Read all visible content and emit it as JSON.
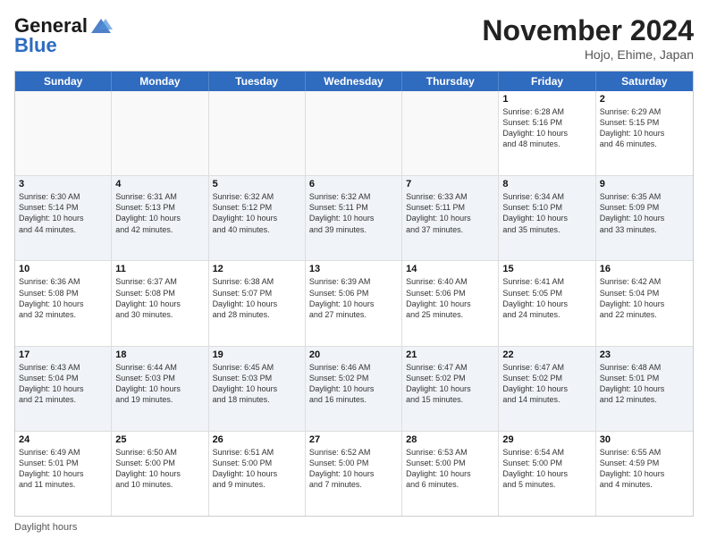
{
  "header": {
    "logo_line1": "General",
    "logo_line2": "Blue",
    "month_title": "November 2024",
    "location": "Hojo, Ehime, Japan"
  },
  "weekdays": [
    "Sunday",
    "Monday",
    "Tuesday",
    "Wednesday",
    "Thursday",
    "Friday",
    "Saturday"
  ],
  "footer": {
    "daylight_label": "Daylight hours"
  },
  "rows": [
    [
      {
        "day": "",
        "text": "",
        "empty": true
      },
      {
        "day": "",
        "text": "",
        "empty": true
      },
      {
        "day": "",
        "text": "",
        "empty": true
      },
      {
        "day": "",
        "text": "",
        "empty": true
      },
      {
        "day": "",
        "text": "",
        "empty": true
      },
      {
        "day": "1",
        "text": "Sunrise: 6:28 AM\nSunset: 5:16 PM\nDaylight: 10 hours\nand 48 minutes.",
        "empty": false
      },
      {
        "day": "2",
        "text": "Sunrise: 6:29 AM\nSunset: 5:15 PM\nDaylight: 10 hours\nand 46 minutes.",
        "empty": false
      }
    ],
    [
      {
        "day": "3",
        "text": "Sunrise: 6:30 AM\nSunset: 5:14 PM\nDaylight: 10 hours\nand 44 minutes.",
        "empty": false
      },
      {
        "day": "4",
        "text": "Sunrise: 6:31 AM\nSunset: 5:13 PM\nDaylight: 10 hours\nand 42 minutes.",
        "empty": false
      },
      {
        "day": "5",
        "text": "Sunrise: 6:32 AM\nSunset: 5:12 PM\nDaylight: 10 hours\nand 40 minutes.",
        "empty": false
      },
      {
        "day": "6",
        "text": "Sunrise: 6:32 AM\nSunset: 5:11 PM\nDaylight: 10 hours\nand 39 minutes.",
        "empty": false
      },
      {
        "day": "7",
        "text": "Sunrise: 6:33 AM\nSunset: 5:11 PM\nDaylight: 10 hours\nand 37 minutes.",
        "empty": false
      },
      {
        "day": "8",
        "text": "Sunrise: 6:34 AM\nSunset: 5:10 PM\nDaylight: 10 hours\nand 35 minutes.",
        "empty": false
      },
      {
        "day": "9",
        "text": "Sunrise: 6:35 AM\nSunset: 5:09 PM\nDaylight: 10 hours\nand 33 minutes.",
        "empty": false
      }
    ],
    [
      {
        "day": "10",
        "text": "Sunrise: 6:36 AM\nSunset: 5:08 PM\nDaylight: 10 hours\nand 32 minutes.",
        "empty": false
      },
      {
        "day": "11",
        "text": "Sunrise: 6:37 AM\nSunset: 5:08 PM\nDaylight: 10 hours\nand 30 minutes.",
        "empty": false
      },
      {
        "day": "12",
        "text": "Sunrise: 6:38 AM\nSunset: 5:07 PM\nDaylight: 10 hours\nand 28 minutes.",
        "empty": false
      },
      {
        "day": "13",
        "text": "Sunrise: 6:39 AM\nSunset: 5:06 PM\nDaylight: 10 hours\nand 27 minutes.",
        "empty": false
      },
      {
        "day": "14",
        "text": "Sunrise: 6:40 AM\nSunset: 5:06 PM\nDaylight: 10 hours\nand 25 minutes.",
        "empty": false
      },
      {
        "day": "15",
        "text": "Sunrise: 6:41 AM\nSunset: 5:05 PM\nDaylight: 10 hours\nand 24 minutes.",
        "empty": false
      },
      {
        "day": "16",
        "text": "Sunrise: 6:42 AM\nSunset: 5:04 PM\nDaylight: 10 hours\nand 22 minutes.",
        "empty": false
      }
    ],
    [
      {
        "day": "17",
        "text": "Sunrise: 6:43 AM\nSunset: 5:04 PM\nDaylight: 10 hours\nand 21 minutes.",
        "empty": false
      },
      {
        "day": "18",
        "text": "Sunrise: 6:44 AM\nSunset: 5:03 PM\nDaylight: 10 hours\nand 19 minutes.",
        "empty": false
      },
      {
        "day": "19",
        "text": "Sunrise: 6:45 AM\nSunset: 5:03 PM\nDaylight: 10 hours\nand 18 minutes.",
        "empty": false
      },
      {
        "day": "20",
        "text": "Sunrise: 6:46 AM\nSunset: 5:02 PM\nDaylight: 10 hours\nand 16 minutes.",
        "empty": false
      },
      {
        "day": "21",
        "text": "Sunrise: 6:47 AM\nSunset: 5:02 PM\nDaylight: 10 hours\nand 15 minutes.",
        "empty": false
      },
      {
        "day": "22",
        "text": "Sunrise: 6:47 AM\nSunset: 5:02 PM\nDaylight: 10 hours\nand 14 minutes.",
        "empty": false
      },
      {
        "day": "23",
        "text": "Sunrise: 6:48 AM\nSunset: 5:01 PM\nDaylight: 10 hours\nand 12 minutes.",
        "empty": false
      }
    ],
    [
      {
        "day": "24",
        "text": "Sunrise: 6:49 AM\nSunset: 5:01 PM\nDaylight: 10 hours\nand 11 minutes.",
        "empty": false
      },
      {
        "day": "25",
        "text": "Sunrise: 6:50 AM\nSunset: 5:00 PM\nDaylight: 10 hours\nand 10 minutes.",
        "empty": false
      },
      {
        "day": "26",
        "text": "Sunrise: 6:51 AM\nSunset: 5:00 PM\nDaylight: 10 hours\nand 9 minutes.",
        "empty": false
      },
      {
        "day": "27",
        "text": "Sunrise: 6:52 AM\nSunset: 5:00 PM\nDaylight: 10 hours\nand 7 minutes.",
        "empty": false
      },
      {
        "day": "28",
        "text": "Sunrise: 6:53 AM\nSunset: 5:00 PM\nDaylight: 10 hours\nand 6 minutes.",
        "empty": false
      },
      {
        "day": "29",
        "text": "Sunrise: 6:54 AM\nSunset: 5:00 PM\nDaylight: 10 hours\nand 5 minutes.",
        "empty": false
      },
      {
        "day": "30",
        "text": "Sunrise: 6:55 AM\nSunset: 4:59 PM\nDaylight: 10 hours\nand 4 minutes.",
        "empty": false
      }
    ]
  ]
}
